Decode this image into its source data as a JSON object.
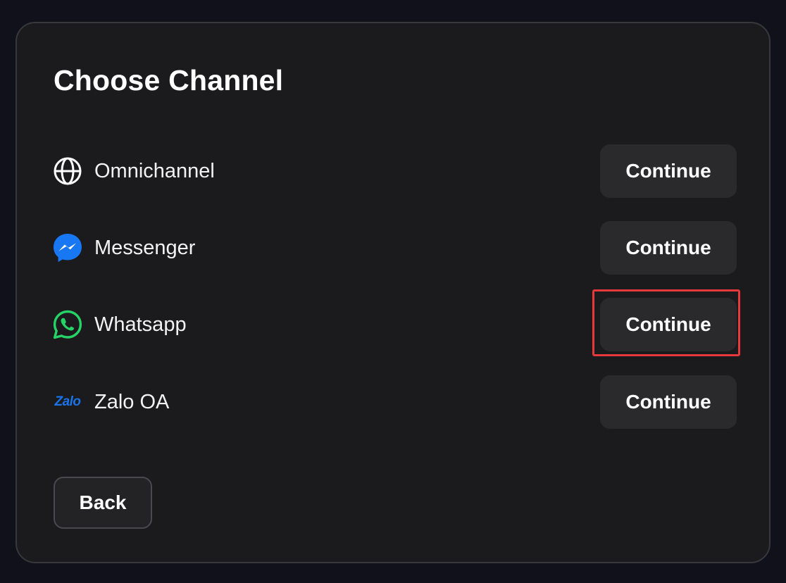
{
  "dialog": {
    "title": "Choose Channel",
    "back_label": "Back"
  },
  "channels": [
    {
      "name": "Omnichannel",
      "icon": "globe-icon",
      "button_label": "Continue"
    },
    {
      "name": "Messenger",
      "icon": "messenger-icon",
      "button_label": "Continue",
      "icon_color": "#1877f2"
    },
    {
      "name": "Whatsapp",
      "icon": "whatsapp-icon",
      "button_label": "Continue",
      "icon_color": "#25d366",
      "highlighted": true
    },
    {
      "name": "Zalo OA",
      "icon": "zalo-icon",
      "icon_text": "Zalo",
      "button_label": "Continue",
      "icon_color": "#1a73e8"
    }
  ],
  "colors": {
    "page_background": "#10111a",
    "dialog_background": "#1b1b1d",
    "button_background": "#2a2a2d",
    "highlight_border": "#e5393c"
  }
}
